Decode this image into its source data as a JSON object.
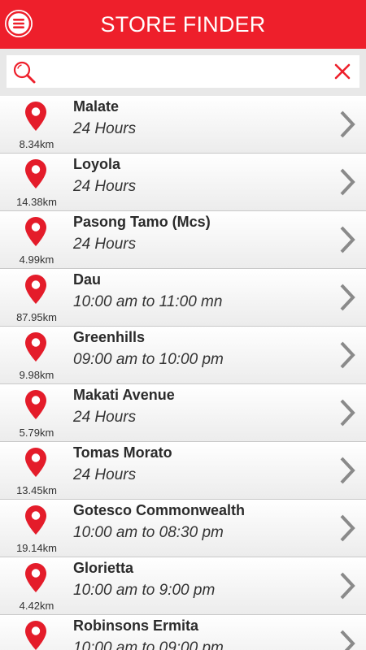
{
  "header": {
    "title": "STORE FINDER",
    "menu_icon": "hamburger-menu-icon",
    "color": "#ee1f2b"
  },
  "search": {
    "value": "",
    "placeholder": "",
    "search_icon": "search-icon",
    "clear_icon": "close-icon"
  },
  "stores": [
    {
      "name": "Malate",
      "hours": "24 Hours",
      "distance": "8.34km"
    },
    {
      "name": "Loyola",
      "hours": "24 Hours",
      "distance": "14.38km"
    },
    {
      "name": "Pasong Tamo (Mcs)",
      "hours": "24 Hours",
      "distance": "4.99km"
    },
    {
      "name": "Dau",
      "hours": "10:00 am to 11:00 mn",
      "distance": "87.95km"
    },
    {
      "name": "Greenhills",
      "hours": "09:00 am to 10:00 pm",
      "distance": "9.98km"
    },
    {
      "name": "Makati Avenue",
      "hours": "24 Hours",
      "distance": "5.79km"
    },
    {
      "name": "Tomas Morato",
      "hours": "24 Hours",
      "distance": "13.45km"
    },
    {
      "name": "Gotesco Commonwealth",
      "hours": "10:00 am to 08:30 pm",
      "distance": "19.14km"
    },
    {
      "name": "Glorietta",
      "hours": "10:00 am to 9:00 pm",
      "distance": "4.42km"
    },
    {
      "name": "Robinsons Ermita",
      "hours": "10:00 am to 09:00 pm",
      "distance": ""
    }
  ]
}
